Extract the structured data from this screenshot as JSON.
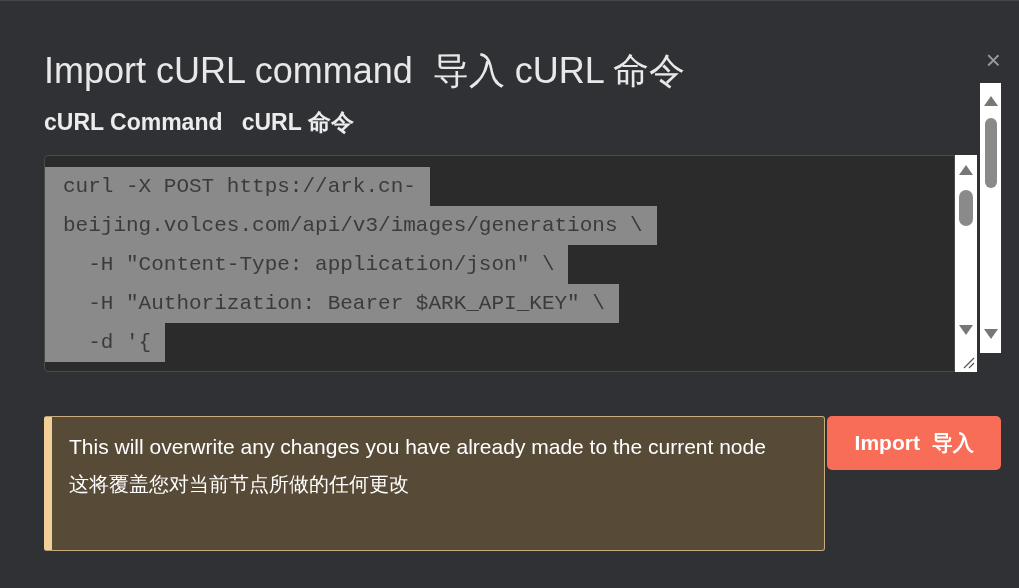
{
  "dialog": {
    "title": "Import cURL command  导入 cURL 命令",
    "close": "×"
  },
  "field": {
    "label": "cURL Command   cURL 命令",
    "lines": [
      "curl -X POST https://ark.cn-",
      "beijing.volces.com/api/v3/images/generations \\",
      "  -H \"Content-Type: application/json\" \\",
      "  -H \"Authorization: Bearer $ARK_API_KEY\" \\",
      "  -d '{"
    ]
  },
  "warning": {
    "lines": [
      "This will overwrite any changes you have already made to the current node",
      "这将覆盖您对当前节点所做的任何更改"
    ]
  },
  "buttons": [
    {
      "label": "Import  导入"
    }
  ]
}
